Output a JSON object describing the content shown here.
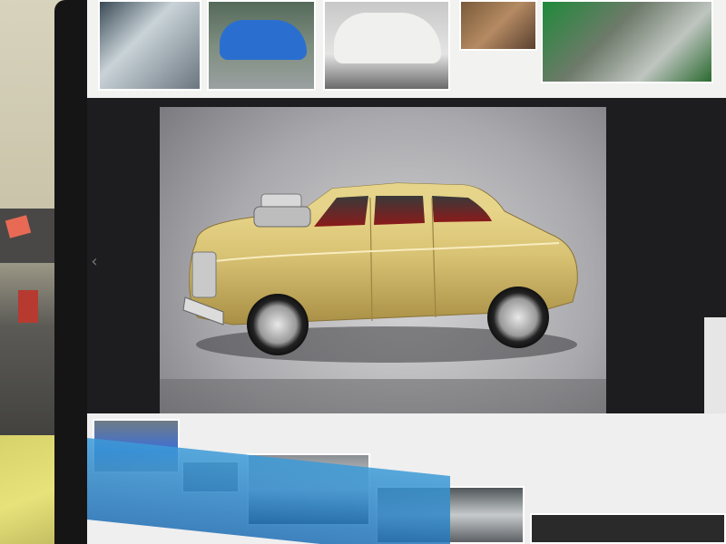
{
  "scene": {
    "description_colors": {
      "car_body": "#d9c374",
      "viewer_bg": "#a9a9ad",
      "monitor_bezel": "#151515"
    }
  },
  "viewer": {
    "prev_arrow": "‹"
  },
  "thumbnails_top": [
    {
      "name": "thumb-car-interior"
    },
    {
      "name": "thumb-blue-car"
    },
    {
      "name": "thumb-white-car"
    },
    {
      "name": "thumb-rusty-car"
    },
    {
      "name": "thumb-engine"
    }
  ],
  "thumbnails_bottom": [
    {
      "name": "thumb-blue-car-street"
    },
    {
      "name": "thumb-old-photo"
    },
    {
      "name": "thumb-car-showroom"
    },
    {
      "name": "thumb-car-bw"
    },
    {
      "name": "thumb-dark"
    }
  ]
}
